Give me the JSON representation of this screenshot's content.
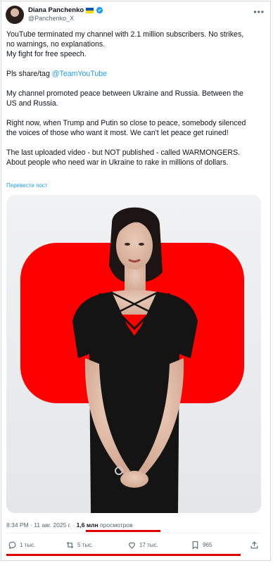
{
  "author": {
    "name": "Diana Panchenko",
    "handle": "@Panchenko_X"
  },
  "post": {
    "p1_line1": "YouTube terminated my channel with 2.1 million subscribers. No strikes,",
    "p1_line2": "no warnings, no explanations.",
    "p1_line3": "My fight for free speech.",
    "p2_prefix": "Pls share/tag ",
    "p2_mention": "@TeamYouTube",
    "p3_line1": "My channel promoted peace between Ukraine and Russia. Between the",
    "p3_line2": "US and Russia.",
    "p4_line1": "Right now, when Trump and Putin so close to peace, somebody silenced",
    "p4_line2": "the voices of those who want it most. We can't let peace get ruined!",
    "p5_line1": "The last uploaded video - but NOT published - called WARMONGERS.",
    "p5_line2": "About people who need war in Ukraine to rake in millions of dollars.",
    "translate": "Перевести пост"
  },
  "meta": {
    "time_date": "8:34 PM · 11 авг. 2025 г. · ",
    "views_count": "1,6 млн",
    "views_label": " просмотров"
  },
  "actions": {
    "replies": "1 тыс.",
    "reposts": "5 тыс.",
    "likes": "17 тыс.",
    "bookmarks": "965"
  },
  "colors": {
    "accent": "#1d9bf0",
    "highlight_underline": "#e00000",
    "youtube_red": "#ff0000"
  }
}
